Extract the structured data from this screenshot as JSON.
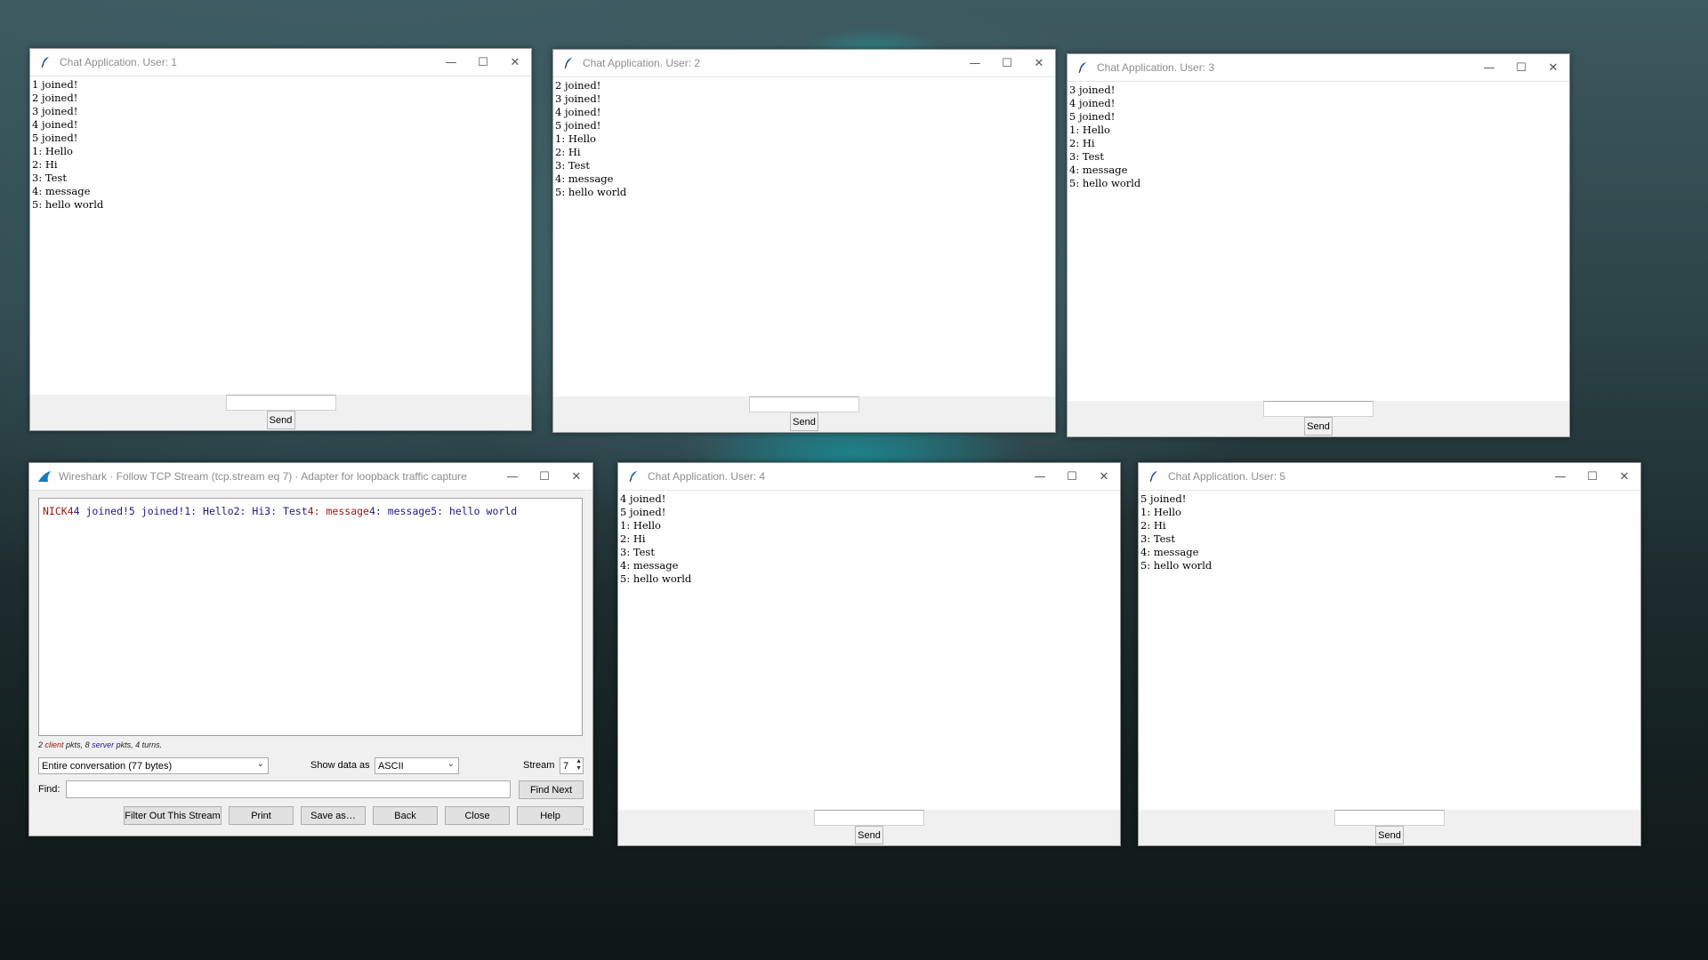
{
  "desktop": {
    "accent": "#18d3d8"
  },
  "chat_windows": [
    {
      "title": "Chat Application. User: 1",
      "lines": [
        "1 joined!",
        "2 joined!",
        "3 joined!",
        "4 joined!",
        "5 joined!",
        "1: Hello",
        "2: Hi",
        "3: Test",
        "4: message",
        "5: hello world"
      ],
      "input_value": "",
      "send_label": "Send"
    },
    {
      "title": "Chat Application. User: 2",
      "lines": [
        "2 joined!",
        "3 joined!",
        "4 joined!",
        "5 joined!",
        "1: Hello",
        "2: Hi",
        "3: Test",
        "4: message",
        "5: hello world"
      ],
      "input_value": "",
      "send_label": "Send"
    },
    {
      "title": "Chat Application. User: 3",
      "lines": [
        "3 joined!",
        "4 joined!",
        "5 joined!",
        "1: Hello",
        "2: Hi",
        "3: Test",
        "4: message",
        "5: hello world"
      ],
      "input_value": "",
      "send_label": "Send"
    },
    {
      "title": "Chat Application. User: 4",
      "lines": [
        "4 joined!",
        "5 joined!",
        "1: Hello",
        "2: Hi",
        "3: Test",
        "4: message",
        "5: hello world"
      ],
      "input_value": "",
      "send_label": "Send"
    },
    {
      "title": "Chat Application. User: 5",
      "lines": [
        "5 joined!",
        "1: Hello",
        "2: Hi",
        "3: Test",
        "4: message",
        "5: hello world"
      ],
      "input_value": "",
      "send_label": "Send"
    }
  ],
  "wireshark": {
    "title": "Wireshark · Follow TCP Stream (tcp.stream eq 7) · Adapter for loopback traffic capture",
    "stream_segments": [
      {
        "text": "NICK4",
        "dir": "client"
      },
      {
        "text": "4 joined!5 joined!1: Hello2: Hi3: Test",
        "dir": "server"
      },
      {
        "text": "4: message",
        "dir": "client"
      },
      {
        "text": "4: message5: hello world",
        "dir": "server"
      }
    ],
    "colors": {
      "client": "#a31515",
      "server": "#1a1a8c"
    },
    "stats": {
      "client_count": "2",
      "client_word": "client",
      "pkts_sep": " pkts, ",
      "server_count": "8",
      "server_word": "server",
      "tail": " pkts, 4 turns."
    },
    "conversation_select": "Entire conversation (77 bytes)",
    "show_data_label": "Show data as",
    "show_data_value": "ASCII",
    "stream_label": "Stream",
    "stream_value": "7",
    "find_label": "Find:",
    "find_value": "",
    "find_next_label": "Find Next",
    "buttons": {
      "filter_out": "Filter Out This Stream",
      "print": "Print",
      "save_as": "Save as…",
      "back": "Back",
      "close": "Close",
      "help": "Help"
    }
  }
}
